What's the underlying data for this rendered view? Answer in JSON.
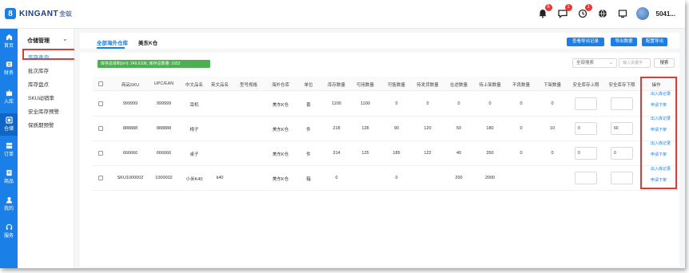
{
  "brand": {
    "mark": "8",
    "text": "KINGANT",
    "cn": "金蚁"
  },
  "header": {
    "badges": [
      "6",
      "1",
      "1"
    ],
    "username": "5041..."
  },
  "leftnav": [
    {
      "label": "首页",
      "icon": "home-icon"
    },
    {
      "label": "财务",
      "icon": "finance-icon"
    },
    {
      "label": "入库",
      "icon": "inbound-icon"
    },
    {
      "label": "仓储",
      "icon": "warehouse-icon"
    },
    {
      "label": "订单",
      "icon": "order-icon"
    },
    {
      "label": "商品",
      "icon": "product-icon"
    },
    {
      "label": "我的",
      "icon": "user-icon"
    },
    {
      "label": "服务",
      "icon": "headset-icon"
    }
  ],
  "subnav": {
    "title": "仓储管理",
    "items": [
      "库存查询",
      "批次库存",
      "库存盘点",
      "SKU动销率",
      "安全库存预警",
      "保质期预警"
    ]
  },
  "tabs": [
    "全部海外仓库",
    "美东K仓"
  ],
  "actions": {
    "export_records": "查看导出记录",
    "export": "导出数据",
    "config_export": "配置导出"
  },
  "inventory_banner": "库存总体积(m³): 249.6106, 库存总数量: 1652",
  "search": {
    "field": "全部搜索",
    "placeholder": "输入关键字",
    "button": "搜索"
  },
  "table": {
    "headers": [
      "商品SKU",
      "UPC/EAN",
      "中文品名",
      "英文品名",
      "型号规格",
      "海外仓库",
      "单位",
      "库存数量",
      "可用数量",
      "可售数量",
      "待发货数量",
      "在途数量",
      "待上架数量",
      "不良数量",
      "下架数量",
      "安全库存上限",
      "安全库存下限",
      "操作"
    ],
    "rows": [
      {
        "sku": "999999",
        "upc": "999999",
        "cn": "耳机",
        "en": "",
        "model": "",
        "wh": "美东K仓",
        "unit": "套",
        "stock": "1100",
        "avail": "1100",
        "sale": "0",
        "pending": "0",
        "transit": "0",
        "shelving": "0",
        "bad": "0",
        "off": "0",
        "upper": "",
        "lower": ""
      },
      {
        "sku": "888888",
        "upc": "888888",
        "cn": "椅子",
        "en": "",
        "model": "",
        "wh": "美东K仓",
        "unit": "件",
        "stock": "218",
        "avail": "128",
        "sale": "90",
        "pending": "120",
        "transit": "50",
        "shelving": "180",
        "bad": "0",
        "off": "10",
        "upper": "0",
        "lower": "60"
      },
      {
        "sku": "666666",
        "upc": "666666",
        "cn": "桌子",
        "en": "",
        "model": "",
        "wh": "美东K仓",
        "unit": "件",
        "stock": "314",
        "avail": "125",
        "sale": "189",
        "pending": "122",
        "transit": "40",
        "shelving": "350",
        "bad": "0",
        "off": "0",
        "upper": "0",
        "lower": "0"
      },
      {
        "sku": "SKU1000002",
        "upc": "1000002",
        "cn": "小米K40",
        "en": "k40",
        "model": "",
        "wh": "美东K仓",
        "unit": "箱",
        "stock": "0",
        "avail": "",
        "sale": "0",
        "pending": "",
        "transit": "200",
        "shelving": "2000",
        "bad": "",
        "off": "",
        "upper": "",
        "lower": ""
      }
    ],
    "op_in_out": "出入库记录",
    "op_delist": "申请下架"
  }
}
